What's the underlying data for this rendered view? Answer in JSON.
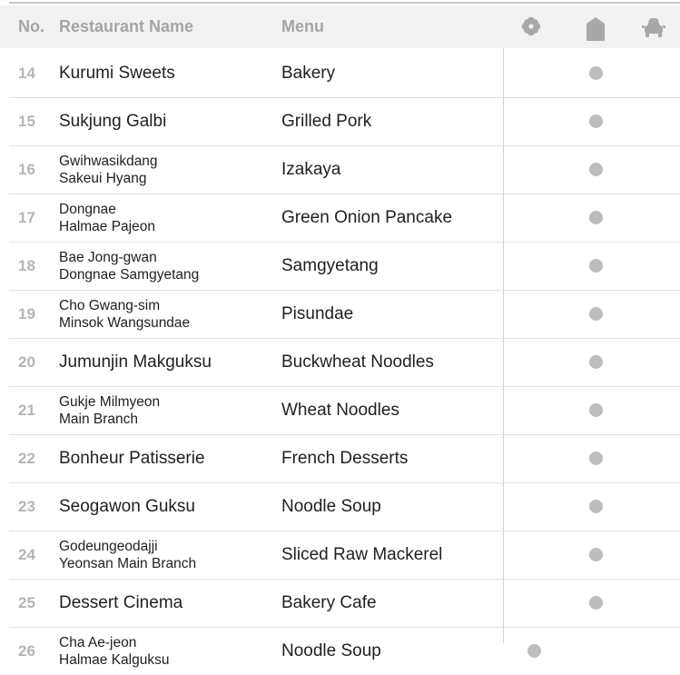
{
  "header": {
    "no": "No.",
    "name": "Restaurant Name",
    "menu": "Menu",
    "icons": [
      "flower-icon",
      "home-icon",
      "car-icon"
    ]
  },
  "rows": [
    {
      "no": "14",
      "name": [
        "Kurumi Sweets"
      ],
      "menu": "Bakery",
      "marks": [
        false,
        true,
        false
      ]
    },
    {
      "no": "15",
      "name": [
        "Sukjung Galbi"
      ],
      "menu": "Grilled Pork",
      "marks": [
        false,
        true,
        false
      ]
    },
    {
      "no": "16",
      "name": [
        "Gwihwasikdang",
        "Sakeui Hyang"
      ],
      "menu": "Izakaya",
      "marks": [
        false,
        true,
        false
      ]
    },
    {
      "no": "17",
      "name": [
        "Dongnae",
        "Halmae Pajeon"
      ],
      "menu": "Green Onion Pancake",
      "marks": [
        false,
        true,
        false
      ]
    },
    {
      "no": "18",
      "name": [
        "Bae Jong-gwan",
        "Dongnae Samgyetang"
      ],
      "menu": "Samgyetang",
      "marks": [
        false,
        true,
        false
      ]
    },
    {
      "no": "19",
      "name": [
        "Cho Gwang-sim",
        "Minsok Wangsundae"
      ],
      "menu": "Pisundae",
      "marks": [
        false,
        true,
        false
      ]
    },
    {
      "no": "20",
      "name": [
        "Jumunjin Makguksu"
      ],
      "menu": "Buckwheat Noodles",
      "marks": [
        false,
        true,
        false
      ]
    },
    {
      "no": "21",
      "name": [
        "Gukje Milmyeon",
        "Main Branch"
      ],
      "menu": "Wheat Noodles",
      "marks": [
        false,
        true,
        false
      ]
    },
    {
      "no": "22",
      "name": [
        "Bonheur Patisserie"
      ],
      "menu": "French Desserts",
      "marks": [
        false,
        true,
        false
      ]
    },
    {
      "no": "23",
      "name": [
        "Seogawon Guksu"
      ],
      "menu": "Noodle Soup",
      "marks": [
        false,
        true,
        false
      ]
    },
    {
      "no": "24",
      "name": [
        "Godeungeodajji",
        "Yeonsan Main Branch"
      ],
      "menu": "Sliced Raw Mackerel",
      "marks": [
        false,
        true,
        false
      ]
    },
    {
      "no": "25",
      "name": [
        "Dessert Cinema"
      ],
      "menu": "Bakery Cafe",
      "marks": [
        false,
        true,
        false
      ]
    },
    {
      "no": "26",
      "name": [
        "Cha Ae-jeon",
        "Halmae Kalguksu"
      ],
      "menu": "Noodle Soup",
      "marks": [
        true,
        false,
        false
      ]
    }
  ],
  "colors": {
    "header_bg": "#f2f2f2",
    "muted": "#a5a5a5",
    "dot": "#bdbdbd",
    "text": "#1f1f1f"
  }
}
